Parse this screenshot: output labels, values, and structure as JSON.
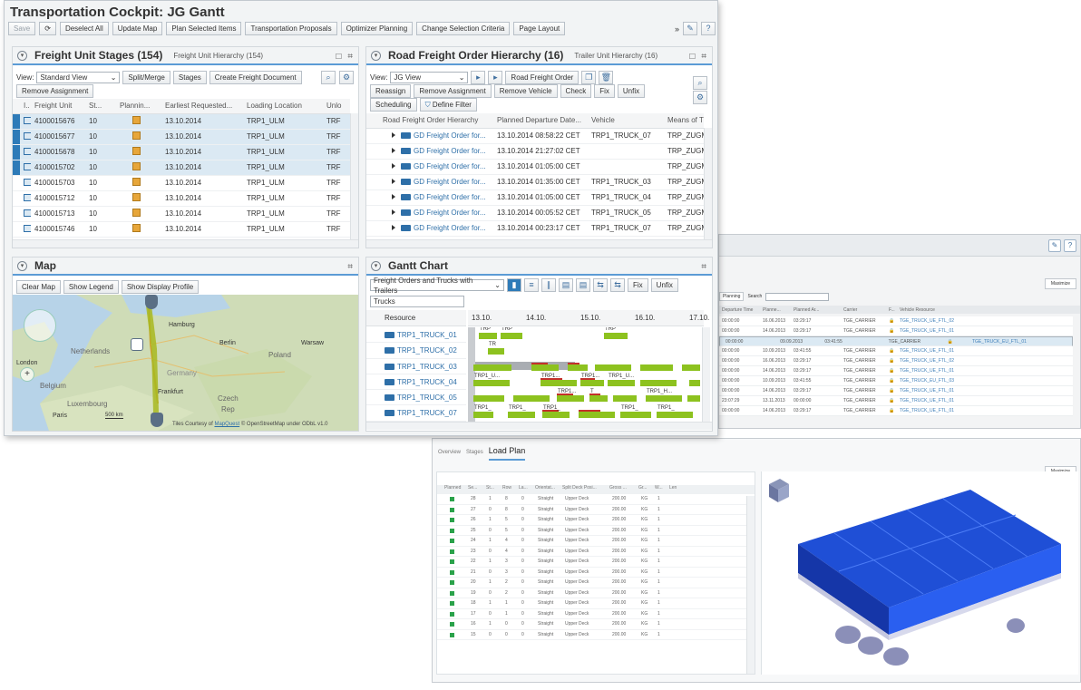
{
  "window": {
    "title": "Transportation Cockpit: JG Gantt",
    "toolbar": {
      "save": "Save",
      "deselect_all": "Deselect All",
      "update_map": "Update Map",
      "plan_selected": "Plan Selected Items",
      "transport_proposals": "Transportation Proposals",
      "optimizer_planning": "Optimizer Planning",
      "change_selection": "Change Selection Criteria",
      "page_layout": "Page Layout"
    }
  },
  "freight_units": {
    "title": "Freight Unit Stages (154)",
    "subtitle": "Freight Unit Hierarchy (154)",
    "view_label": "View:",
    "view_value": "Standard View",
    "buttons": {
      "split_merge": "Split/Merge",
      "stages": "Stages",
      "create_doc": "Create Freight Document",
      "remove_assignment": "Remove Assignment"
    },
    "columns": [
      "I..",
      "Freight Unit",
      "St...",
      "Plannin...",
      "Earliest Requested...",
      "Loading Location",
      "Unlo"
    ],
    "rows": [
      {
        "id": "4100015676",
        "st": "10",
        "date": "13.10.2014",
        "loc": "TRP1_ULM",
        "unl": "TRF"
      },
      {
        "id": "4100015677",
        "st": "10",
        "date": "13.10.2014",
        "loc": "TRP1_ULM",
        "unl": "TRF"
      },
      {
        "id": "4100015678",
        "st": "10",
        "date": "13.10.2014",
        "loc": "TRP1_ULM",
        "unl": "TRF"
      },
      {
        "id": "4100015702",
        "st": "10",
        "date": "13.10.2014",
        "loc": "TRP1_ULM",
        "unl": "TRF"
      },
      {
        "id": "4100015703",
        "st": "10",
        "date": "13.10.2014",
        "loc": "TRP1_ULM",
        "unl": "TRF"
      },
      {
        "id": "4100015712",
        "st": "10",
        "date": "13.10.2014",
        "loc": "TRP1_ULM",
        "unl": "TRF"
      },
      {
        "id": "4100015713",
        "st": "10",
        "date": "13.10.2014",
        "loc": "TRP1_ULM",
        "unl": "TRF"
      },
      {
        "id": "4100015746",
        "st": "10",
        "date": "13.10.2014",
        "loc": "TRP1_ULM",
        "unl": "TRF"
      }
    ]
  },
  "freight_orders": {
    "title": "Road Freight Order Hierarchy (16)",
    "subtitle": "Trailer Unit Hierarchy (16)",
    "view_label": "View:",
    "view_value": "JG View",
    "buttons": {
      "road_fo": "Road Freight Order",
      "reassign": "Reassign",
      "remove_assignment": "Remove Assignment",
      "remove_vehicle": "Remove Vehicle",
      "check": "Check",
      "fix": "Fix",
      "unfix": "Unfix",
      "scheduling": "Scheduling",
      "define_filter": "Define Filter"
    },
    "columns": [
      "Road Freight Order Hierarchy",
      "Planned Departure Date...",
      "Vehicle",
      "Means of Tr"
    ],
    "rows": [
      {
        "name": "GD Freight Order for...",
        "date": "13.10.2014 08:58:22 CET",
        "vehicle": "TRP1_TRUCK_07",
        "means": "TRP_ZUGM"
      },
      {
        "name": "GD Freight Order for...",
        "date": "13.10.2014 21:27:02 CET",
        "vehicle": "",
        "means": "TRP_ZUGM"
      },
      {
        "name": "GD Freight Order for...",
        "date": "13.10.2014 01:05:00 CET",
        "vehicle": "",
        "means": "TRP_ZUGM"
      },
      {
        "name": "GD Freight Order for...",
        "date": "13.10.2014 01:35:00 CET",
        "vehicle": "TRP1_TRUCK_03",
        "means": "TRP_ZUGM"
      },
      {
        "name": "GD Freight Order for...",
        "date": "13.10.2014 01:05:00 CET",
        "vehicle": "TRP1_TRUCK_04",
        "means": "TRP_ZUGM"
      },
      {
        "name": "GD Freight Order for...",
        "date": "13.10.2014 00:05:52 CET",
        "vehicle": "TRP1_TRUCK_05",
        "means": "TRP_ZUGM"
      },
      {
        "name": "GD Freight Order for...",
        "date": "13.10.2014 00:23:17 CET",
        "vehicle": "TRP1_TRUCK_07",
        "means": "TRP_ZUGM"
      }
    ]
  },
  "map": {
    "title": "Map",
    "buttons": {
      "clear": "Clear Map",
      "legend": "Show Legend",
      "profile": "Show Display Profile"
    },
    "labels": {
      "hamburg": "Hamburg",
      "berlin": "Berlin",
      "poland": "Poland",
      "warsaw": "Warsaw",
      "netherlands": "Netherlands",
      "london": "London",
      "belgium": "Belgium",
      "germany": "Germany",
      "luxembourg": "Luxembourg",
      "paris": "Paris",
      "czech": "Czech",
      "rep": "Rep",
      "frankfurt": "Frankfurt"
    },
    "scale": "500 km",
    "attribution_prefix": "Tiles Courtesy of",
    "attribution_link": "MapQuest",
    "attribution_suffix": "© OpenStreetMap under ODbL v1.0"
  },
  "gantt": {
    "title": "Gantt Chart",
    "view_value": "Freight Orders and Trucks with Trailers",
    "buttons": {
      "fix": "Fix",
      "unfix": "Unfix"
    },
    "filter": "Trucks",
    "resource_header": "Resource",
    "dates": [
      "13.10.",
      "14.10.",
      "15.10.",
      "16.10.",
      "17.10."
    ],
    "resources": [
      "TRP1_TRUCK_01",
      "TRP1_TRUCK_02",
      "TRP1_TRUCK_03",
      "TRP1_TRUCK_04",
      "TRP1_TRUCK_05",
      "TRP1_TRUCK_07"
    ],
    "bar_labels": {
      "trp": "TRP",
      "tr": "TR",
      "trp1u": "TRP1_U...",
      "trp1": "TRP1...",
      "trp1h": "TRP1_H...",
      "trp1_": "TRP1_",
      "t": "T"
    }
  },
  "bg_window": {
    "columns": [
      "Departure Time",
      "Planne...",
      "Planned Ar...",
      "Carrier",
      "F...",
      "Vehicle Resource"
    ],
    "search_tab": "Planning",
    "search_label": "Search",
    "maximize": "Maximize",
    "rows": [
      {
        "t": "00:00:00",
        "p": "16.06.2013",
        "a": "03:29:17",
        "c": "TGE_CARRIER",
        "v": "TGE_TRUCK_UE_FTL_02",
        "sel": false
      },
      {
        "t": "00:00:00",
        "p": "14.06.2013",
        "a": "03:29:17",
        "c": "TGE_CARRIER",
        "v": "TGE_TRUCK_UE_FTL_01",
        "sel": false
      },
      {
        "t": "00:00:00",
        "p": "09.09.2013",
        "a": "03:41:55",
        "c": "TGE_CARRIER",
        "v": "TGE_TRUCK_EU_FTL_01",
        "sel": true
      },
      {
        "t": "00:00:00",
        "p": "10.09.2013",
        "a": "03:41:55",
        "c": "TGE_CARRIER",
        "v": "TGE_TRUCK_UE_FTL_01",
        "sel": false
      },
      {
        "t": "00:00:00",
        "p": "16.06.2013",
        "a": "03:29:17",
        "c": "TGE_CARRIER",
        "v": "TGE_TRUCK_UE_FTL_02",
        "sel": false
      },
      {
        "t": "00:00:00",
        "p": "14.06.2013",
        "a": "03:29:17",
        "c": "TGE_CARRIER",
        "v": "TGE_TRUCK_UE_FTL_01",
        "sel": false
      },
      {
        "t": "00:00:00",
        "p": "10.09.2013",
        "a": "03:41:55",
        "c": "TGE_CARRIER",
        "v": "TGE_TRUCK_EU_FTL_03",
        "sel": false
      },
      {
        "t": "00:00:00",
        "p": "14.06.2013",
        "a": "03:29:17",
        "c": "TGE_CARRIER",
        "v": "TGE_TRUCK_UE_FTL_01",
        "sel": false
      },
      {
        "t": "23:07:29",
        "p": "13.11.2013",
        "a": "00:00:00",
        "c": "TGE_CARRIER",
        "v": "TGE_TRUCK_UE_FTL_01",
        "sel": false
      },
      {
        "t": "00:00:00",
        "p": "14.06.2013",
        "a": "03:29:17",
        "c": "TGE_CARRIER",
        "v": "TGE_TRUCK_UE_FTL_01",
        "sel": false
      }
    ]
  },
  "load_plan": {
    "tabs": [
      "Overview",
      "Stages"
    ],
    "active_tab": "Load Plan",
    "maximize": "Maximize",
    "columns": [
      "Planned",
      "Se...",
      "St...",
      "Row",
      "La...",
      "Orientat...",
      "Split Deck Posi...",
      "Gross ...",
      "Gr...",
      "W...",
      "Len"
    ],
    "rows": [
      [
        "28",
        "1",
        "8",
        "0",
        "Straight",
        "Upper Deck",
        "200.00",
        "KG",
        "1"
      ],
      [
        "27",
        "0",
        "8",
        "0",
        "Straight",
        "Upper Deck",
        "200.00",
        "KG",
        "1"
      ],
      [
        "26",
        "1",
        "5",
        "0",
        "Straight",
        "Upper Deck",
        "200.00",
        "KG",
        "1"
      ],
      [
        "25",
        "0",
        "5",
        "0",
        "Straight",
        "Upper Deck",
        "200.00",
        "KG",
        "1"
      ],
      [
        "24",
        "1",
        "4",
        "0",
        "Straight",
        "Upper Deck",
        "200.00",
        "KG",
        "1"
      ],
      [
        "23",
        "0",
        "4",
        "0",
        "Straight",
        "Upper Deck",
        "200.00",
        "KG",
        "1"
      ],
      [
        "22",
        "1",
        "3",
        "0",
        "Straight",
        "Upper Deck",
        "200.00",
        "KG",
        "1"
      ],
      [
        "21",
        "0",
        "3",
        "0",
        "Straight",
        "Upper Deck",
        "200.00",
        "KG",
        "1"
      ],
      [
        "20",
        "1",
        "2",
        "0",
        "Straight",
        "Upper Deck",
        "200.00",
        "KG",
        "1"
      ],
      [
        "19",
        "0",
        "2",
        "0",
        "Straight",
        "Upper Deck",
        "200.00",
        "KG",
        "1"
      ],
      [
        "18",
        "1",
        "1",
        "0",
        "Straight",
        "Upper Deck",
        "200.00",
        "KG",
        "1"
      ],
      [
        "17",
        "0",
        "1",
        "0",
        "Straight",
        "Upper Deck",
        "200.00",
        "KG",
        "1"
      ],
      [
        "16",
        "1",
        "0",
        "0",
        "Straight",
        "Upper Deck",
        "200.00",
        "KG",
        "1"
      ],
      [
        "15",
        "0",
        "0",
        "0",
        "Straight",
        "Upper Deck",
        "200.00",
        "KG",
        "1"
      ]
    ]
  },
  "colors": {
    "accent": "#5b9bd5",
    "link": "#2e6fa8",
    "gantt_bar": "#8dc21f",
    "selected_row": "#dbe9f3",
    "truck_blue": "#1f4fd6"
  }
}
